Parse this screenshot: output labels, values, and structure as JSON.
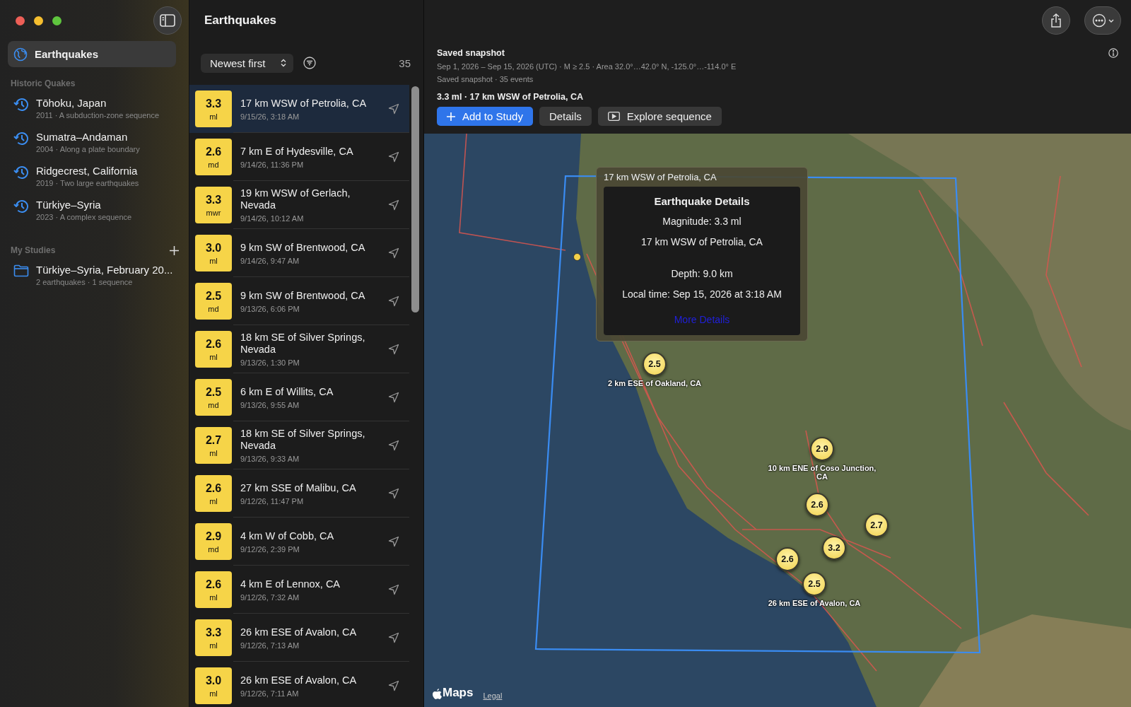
{
  "sidebar": {
    "items": [
      {
        "label": "Earthquakes",
        "kind": "globe",
        "selected": true
      }
    ],
    "sections": [
      {
        "title": "Historic Quakes",
        "addable": false,
        "items": [
          {
            "title": "Tōhoku, Japan",
            "subtitle": "2011 · A subduction-zone sequence",
            "kind": "history",
            "selected": false
          },
          {
            "title": "Sumatra–Andaman",
            "subtitle": "2004 · Along a plate boundary",
            "kind": "history",
            "selected": false
          },
          {
            "title": "Ridgecrest, California",
            "subtitle": "2019 · Two large earthquakes",
            "kind": "history",
            "selected": false
          },
          {
            "title": "Türkiye–Syria",
            "subtitle": "2023 · A complex sequence",
            "kind": "history",
            "selected": false
          }
        ]
      },
      {
        "title": "My Studies",
        "addable": true,
        "items": [
          {
            "title": "Türkiye–Syria, February 20...",
            "subtitle": "2 earthquakes · 1 sequence",
            "kind": "folder",
            "selected": false
          }
        ]
      }
    ]
  },
  "list": {
    "title": "Earthquakes",
    "sort": "Newest first",
    "count": "35",
    "rows": [
      {
        "magnitude": "3.3",
        "type": "ml",
        "place": "17 km WSW of Petrolia, CA",
        "time": "9/15/26, 3:18 AM",
        "selected": true
      },
      {
        "magnitude": "2.6",
        "type": "md",
        "place": "7 km E of Hydesville, CA",
        "time": "9/14/26, 11:36 PM",
        "selected": false
      },
      {
        "magnitude": "3.3",
        "type": "mwr",
        "place": "19 km WSW of Gerlach, Nevada",
        "time": "9/14/26, 10:12 AM",
        "selected": false
      },
      {
        "magnitude": "3.0",
        "type": "ml",
        "place": "9 km SW of Brentwood, CA",
        "time": "9/14/26, 9:47 AM",
        "selected": false
      },
      {
        "magnitude": "2.5",
        "type": "md",
        "place": "9 km SW of Brentwood, CA",
        "time": "9/13/26, 6:06 PM",
        "selected": false
      },
      {
        "magnitude": "2.6",
        "type": "ml",
        "place": "18 km SE of Silver Springs, Nevada",
        "time": "9/13/26, 1:30 PM",
        "selected": false
      },
      {
        "magnitude": "2.5",
        "type": "md",
        "place": "6 km E of Willits, CA",
        "time": "9/13/26, 9:55 AM",
        "selected": false
      },
      {
        "magnitude": "2.7",
        "type": "ml",
        "place": "18 km SE of Silver Springs, Nevada",
        "time": "9/13/26, 9:33 AM",
        "selected": false
      },
      {
        "magnitude": "2.6",
        "type": "ml",
        "place": "27 km SSE of Malibu, CA",
        "time": "9/12/26, 11:47 PM",
        "selected": false
      },
      {
        "magnitude": "2.9",
        "type": "md",
        "place": "4 km W of Cobb, CA",
        "time": "9/12/26, 2:39 PM",
        "selected": false
      },
      {
        "magnitude": "2.6",
        "type": "ml",
        "place": "4 km E of Lennox, CA",
        "time": "9/12/26, 7:32 AM",
        "selected": false
      },
      {
        "magnitude": "3.3",
        "type": "ml",
        "place": "26 km ESE of Avalon, CA",
        "time": "9/12/26, 7:13 AM",
        "selected": false
      },
      {
        "magnitude": "3.0",
        "type": "ml",
        "place": "26 km ESE of Avalon, CA",
        "time": "9/12/26, 7:11 AM",
        "selected": false
      }
    ]
  },
  "detail": {
    "title": "Saved snapshot",
    "summary": "Sep 1, 2026 – Sep 15, 2026 (UTC) · M ≥ 2.5 · Area 32.0°…42.0° N, -125.0°…-114.0° E",
    "status": "Saved snapshot · 35 events",
    "selection": "3.3 ml · 17 km WSW of Petrolia, CA",
    "buttons": [
      {
        "label": "Add to Study",
        "kind": "primary"
      },
      {
        "label": "Details",
        "kind": "plain"
      },
      {
        "label": "Explore sequence",
        "kind": "play"
      }
    ]
  },
  "map": {
    "callout": {
      "title": "17 km WSW of Petrolia, CA",
      "heading": "Earthquake Details",
      "groups": [
        [
          "Magnitude: 3.3 ml",
          "17 km WSW of Petrolia, CA"
        ],
        [
          "Depth: 9.0 km",
          "Local time: Sep 15, 2026 at 3:18 AM"
        ]
      ],
      "link": "More Details"
    },
    "markers": [
      {
        "magnitude": "2.5",
        "label": "2 km ESE of Oakland, CA"
      },
      {
        "magnitude": "2.9",
        "label": "10 km ENE of Coso Junction, CA"
      },
      {
        "magnitude": "2.6"
      },
      {
        "magnitude": "2.7"
      },
      {
        "magnitude": "3.2"
      },
      {
        "magnitude": "2.6"
      },
      {
        "magnitude": "2.5",
        "label": "26 km ESE of Avalon, CA"
      }
    ],
    "logo": "Maps",
    "legal": "Legal"
  }
}
